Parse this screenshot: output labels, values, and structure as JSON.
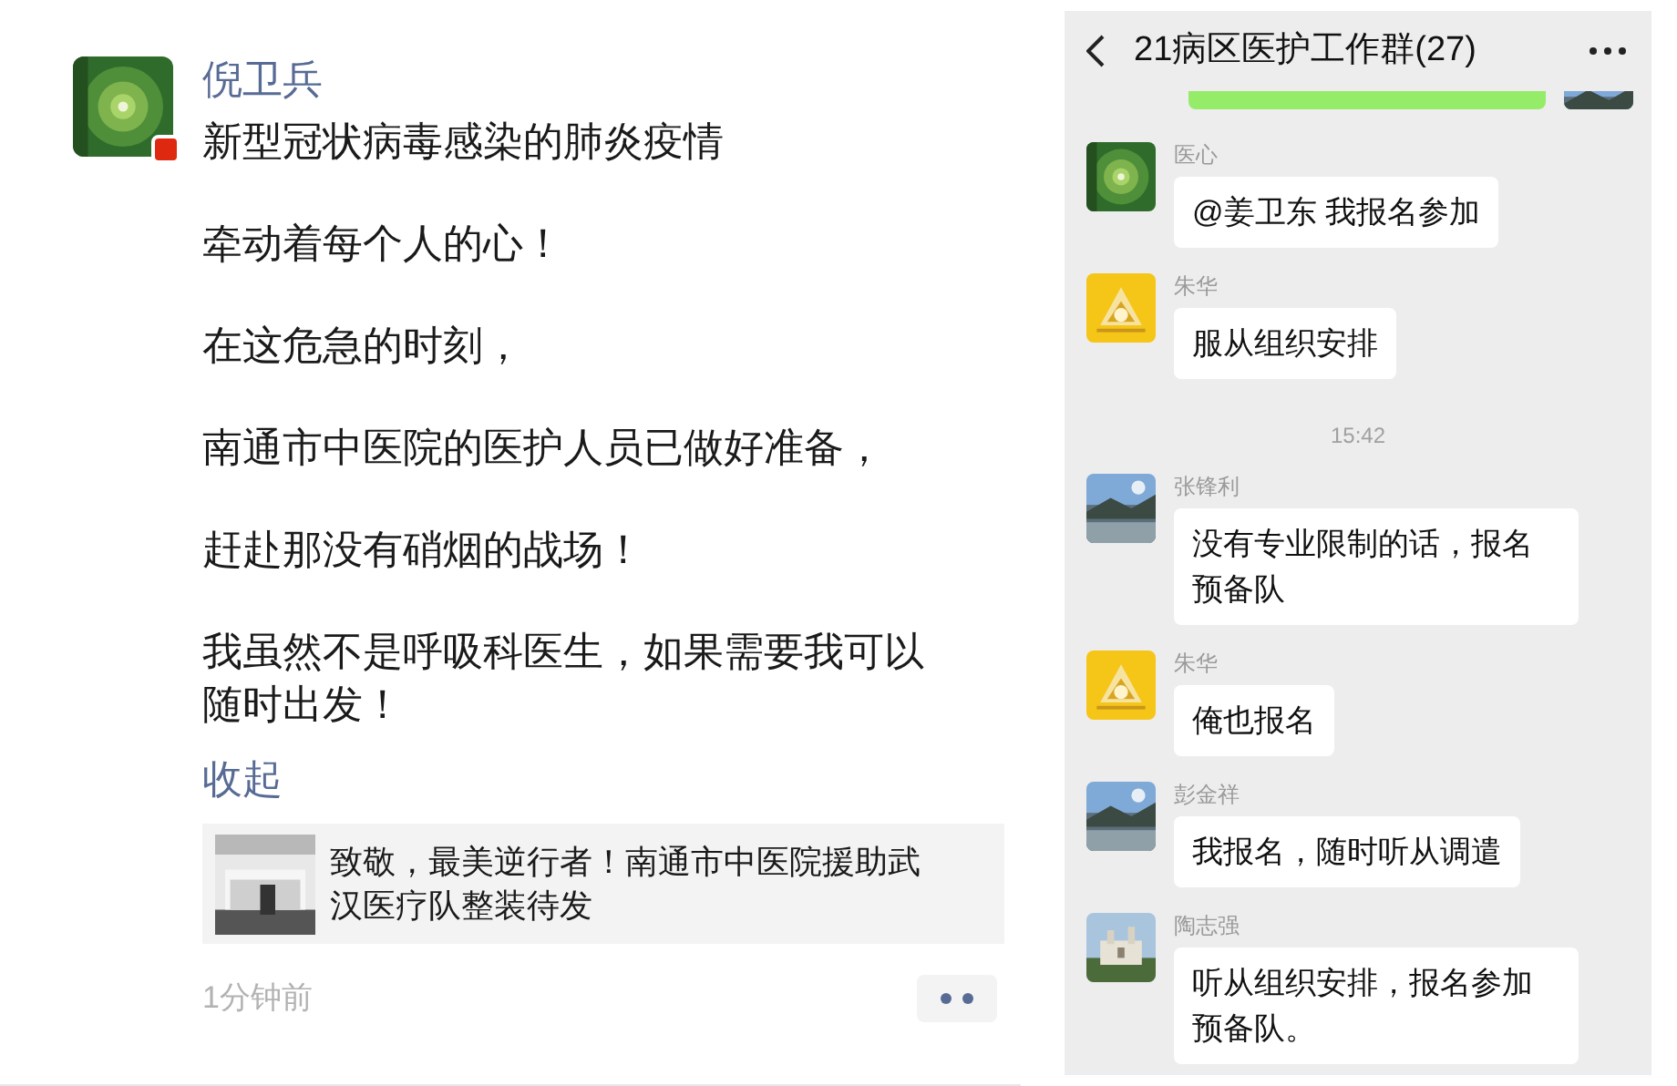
{
  "post": {
    "author": "倪卫兵",
    "paragraphs": [
      "新型冠状病毒感染的肺炎疫情",
      "牵动着每个人的心！",
      "在这危急的时刻，",
      "南通市中医院的医护人员已做好准备，",
      "赶赴那没有硝烟的战场！",
      "我虽然不是呼吸科医生，如果需要我可以随时出发！"
    ],
    "collapse_link": "收起",
    "shared_link": {
      "title": "致敬，最美逆行者！南通市中医院援助武汉医疗队整装待发"
    },
    "time": "1分钟前"
  },
  "chat": {
    "title": "21病区医护工作群(27)",
    "messages": [
      {
        "kind": "message",
        "sender": "医心",
        "text": "@姜卫东  我报名参加"
      },
      {
        "kind": "message",
        "sender": "朱华",
        "text": "服从组织安排"
      },
      {
        "kind": "time",
        "text": "15:42"
      },
      {
        "kind": "message",
        "sender": "张锋利",
        "text": "没有专业限制的话，报名预备队"
      },
      {
        "kind": "message",
        "sender": "朱华",
        "text": "俺也报名"
      },
      {
        "kind": "message",
        "sender": "彭金祥",
        "text": "我报名，随时听从调遣"
      },
      {
        "kind": "message",
        "sender": "陶志强",
        "text": "听从组织安排，报名参加预备队。"
      }
    ]
  }
}
